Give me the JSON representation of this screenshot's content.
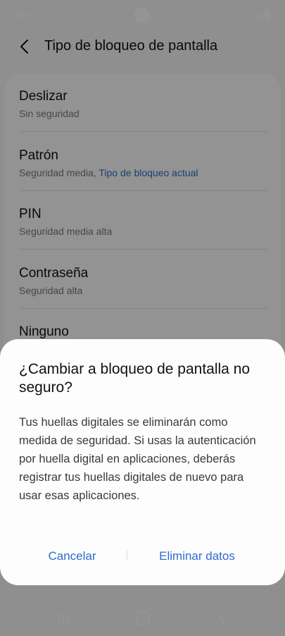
{
  "status_bar": {
    "time": "10:00",
    "icons": [
      "signal-icon",
      "battery-icon"
    ]
  },
  "header": {
    "title": "Tipo de bloqueo de pantalla",
    "back_icon": "chevron-left-icon"
  },
  "options": [
    {
      "title": "Deslizar",
      "subtitle": "Sin seguridad",
      "subtitle_accent": ""
    },
    {
      "title": "Patrón",
      "subtitle": "Seguridad media, ",
      "subtitle_accent": "Tipo de bloqueo actual"
    },
    {
      "title": "PIN",
      "subtitle": "Seguridad media alta",
      "subtitle_accent": ""
    },
    {
      "title": "Contraseña",
      "subtitle": "Seguridad alta",
      "subtitle_accent": ""
    },
    {
      "title": "Ninguno",
      "subtitle": "",
      "subtitle_accent": ""
    }
  ],
  "dialog": {
    "title": "¿Cambiar a bloqueo de pantalla no seguro?",
    "message": "Tus huellas digitales se eliminarán como medida de seguridad. Si usas la autenticación por huella digital en aplicaciones, deberás registrar tus huellas digitales de nuevo para usar esas aplicaciones.",
    "cancel_label": "Cancelar",
    "confirm_label": "Eliminar datos"
  },
  "nav_bar": {
    "icons": [
      "recent-apps-icon",
      "home-icon",
      "back-icon"
    ]
  },
  "colors": {
    "accent": "#2e6bcc",
    "background": "#f6f6f6",
    "card": "#fdfdfd",
    "scrim": "rgba(0,0,0,0.42)"
  }
}
